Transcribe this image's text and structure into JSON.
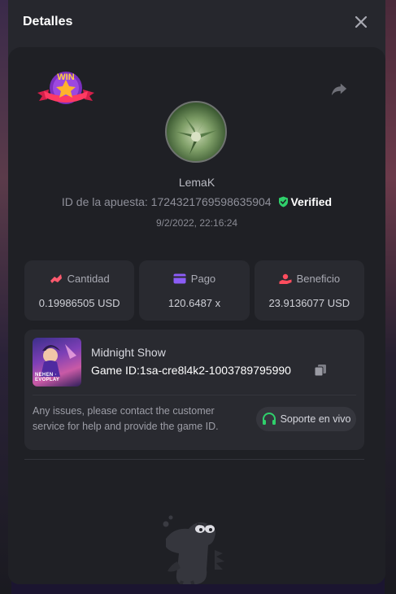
{
  "modal": {
    "title": "Detalles",
    "close_icon": "close-icon"
  },
  "bet": {
    "username": "LemaK",
    "id_label": "ID de la apuesta:",
    "id_value": "1724321769598635904",
    "verified": "Verified",
    "timestamp": "9/2/2022, 22:16:24",
    "badge": "WIN"
  },
  "stats": [
    {
      "icon": "coins-icon",
      "label": "Cantidad",
      "value": "0.19986505 USD",
      "color": "#ff5a6e"
    },
    {
      "icon": "card-icon",
      "label": "Pago",
      "value": "120.6487 x",
      "color": "#8b5cf6"
    },
    {
      "icon": "hand-coin-icon",
      "label": "Beneficio",
      "value": "23.9136077 USD",
      "color": "#ff4d5e"
    }
  ],
  "game": {
    "name": "Midnight Show",
    "id_label": "Game ID:",
    "id_value": "1sa-cre8l4k2-1003789795990",
    "thumb_label": "NEHEN · EVOPLAY",
    "issues_text": "Any issues, please contact the customer service for help and provide the game ID.",
    "support_label": "Soporte en vivo"
  },
  "colors": {
    "accent_green": "#2fd06b",
    "modal_bg": "#26272d",
    "card_bg": "#1f2025"
  }
}
